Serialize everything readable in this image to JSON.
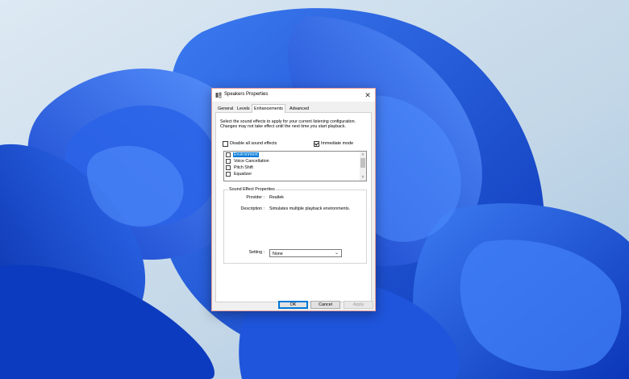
{
  "window": {
    "title": "Speakers Properties",
    "close_glyph": "✕",
    "icon": "speaker-icon"
  },
  "tabs": [
    {
      "label": "General",
      "active": false
    },
    {
      "label": "Levels",
      "active": false
    },
    {
      "label": "Enhancements",
      "active": true
    },
    {
      "label": "Advanced",
      "active": false
    }
  ],
  "enhancements": {
    "description": "Select the sound effects to apply for your current listening configuration. Changes may not take effect until the next time you start playback.",
    "disable_all": {
      "label": "Disable all sound effects",
      "checked": false
    },
    "immediate_mode": {
      "label": "Immediate mode",
      "checked": true
    },
    "effects": [
      {
        "label": "Environment",
        "checked": false,
        "selected": true
      },
      {
        "label": "Voice Cancellation",
        "checked": false,
        "selected": false
      },
      {
        "label": "Pitch Shift",
        "checked": false,
        "selected": false
      },
      {
        "label": "Equalizer",
        "checked": false,
        "selected": false
      }
    ],
    "properties": {
      "group_title": "Sound Effect Properties",
      "provider_label": "Provider :",
      "provider_value": "Realtek",
      "description_label": "Description :",
      "description_value": "Simulates multiple playback environments.",
      "setting_label": "Setting :",
      "setting_value": "None"
    }
  },
  "buttons": {
    "ok": "OK",
    "cancel": "Cancel",
    "apply": "Apply"
  },
  "colors": {
    "accent": "#0078d7",
    "wallpaper_bg": "#c9dcea",
    "bloom": "#1a4fd6"
  }
}
